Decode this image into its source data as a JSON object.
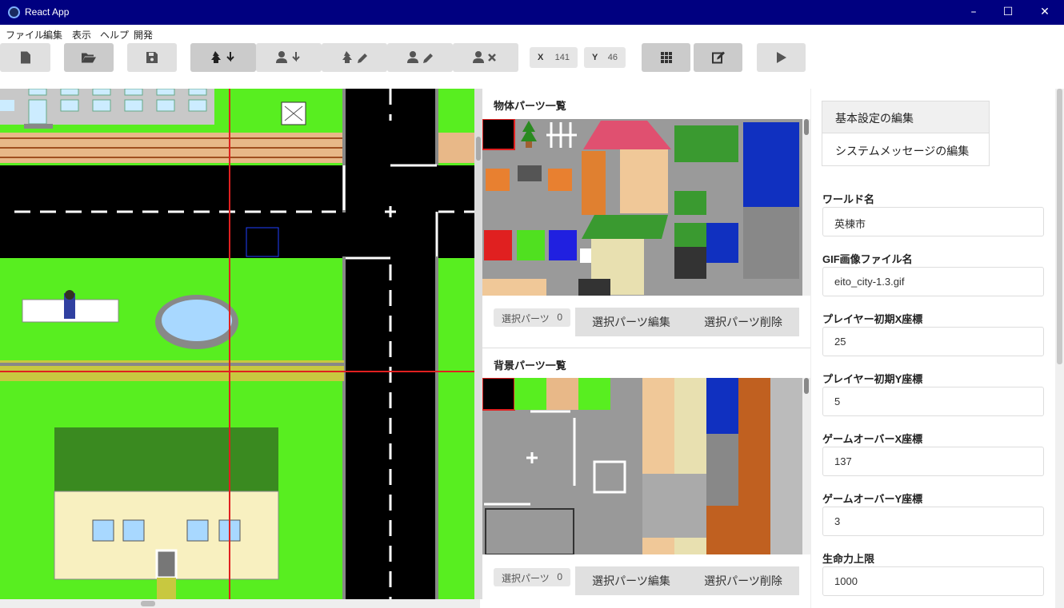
{
  "window": {
    "title": "React App",
    "minimize": "–",
    "maximize": "☐",
    "close": "✕"
  },
  "menu": [
    "ファイル",
    "編集",
    "表示",
    "ヘルプ",
    "開発"
  ],
  "toolbar": {
    "buttons": [
      "new-file-icon",
      "open-folder-icon",
      "save-icon",
      "tree-down-icon",
      "person-down-icon",
      "tree-edit-icon",
      "person-edit-icon",
      "person-delete-icon",
      "grid-icon",
      "edit-icon",
      "play-icon"
    ],
    "x_label": "X",
    "x_value": "141",
    "y_label": "Y",
    "y_value": "46"
  },
  "objects_panel": {
    "title": "物体パーツ一覧",
    "selected_label": "選択パーツ",
    "selected_count": "0",
    "edit_label": "選択パーツ編集",
    "delete_label": "選択パーツ削除"
  },
  "background_panel": {
    "title": "背景パーツ一覧",
    "selected_label": "選択パーツ",
    "selected_count": "0",
    "edit_label": "選択パーツ編集",
    "delete_label": "選択パーツ削除"
  },
  "settings": {
    "tabs": [
      "基本設定の編集",
      "システムメッセージの編集"
    ],
    "fields": [
      {
        "label": "ワールド名",
        "value": "英棟市"
      },
      {
        "label": "GIF画像ファイル名",
        "value": "eito_city-1.3.gif"
      },
      {
        "label": "プレイヤー初期X座標",
        "value": "25"
      },
      {
        "label": "プレイヤー初期Y座標",
        "value": "5"
      },
      {
        "label": "ゲームオーバーX座標",
        "value": "137"
      },
      {
        "label": "ゲームオーバーY座標",
        "value": "3"
      },
      {
        "label": "生命力上限",
        "value": "1000"
      }
    ]
  },
  "colors": {
    "titlebar": "#000080",
    "grass": "#58ee20",
    "road": "#000000",
    "crosshair": "#e02020"
  }
}
